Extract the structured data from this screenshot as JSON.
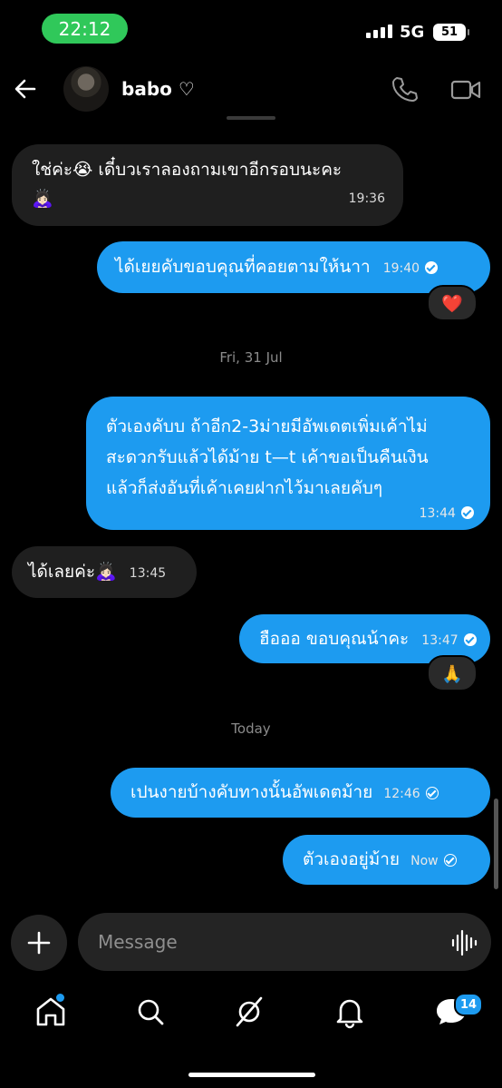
{
  "status": {
    "time": "22:12",
    "network": "5G",
    "battery": "51"
  },
  "header": {
    "name": "babo ♡"
  },
  "messages": [
    {
      "dir": "in",
      "text1": "ใช่ค่ะ😭 เดี๋บวเราลองถามเขาอีกรอบนะคะ",
      "text2": "🙇🏻‍♀️",
      "time": "19:36"
    },
    {
      "dir": "out",
      "text": "ได้เยยคับขอบคุณที่คอยตามให้นาา",
      "time": "19:40",
      "reaction": "❤️"
    },
    {
      "dir": "out",
      "lines": [
        "ตัวเองคับบ ถ้าอีก2-3ม่ายมีอัพเดตเพิ่มเค้าไม่",
        "สะดวกรับแล้วได้ม้าย t—t เค้าขอเป็นคืนเงิน",
        "แล้วก็ส่งอันที่เค้าเคยฝากไว้มาเลยคับๆ"
      ],
      "time": "13:44"
    },
    {
      "dir": "in",
      "text": "ได้เลยค่ะ🙇🏻‍♀️",
      "time": "13:45"
    },
    {
      "dir": "out",
      "text": "ฮือออ ขอบคุณน้าคะ",
      "time": "13:47",
      "reaction": "🙏"
    },
    {
      "dir": "out",
      "text": "เปนงายบ้างคับทางนั้นอัพเดตม้าย",
      "time": "12:46"
    },
    {
      "dir": "out",
      "text": "ตัวเองอยู่ม้าย",
      "time": "Now"
    }
  ],
  "separators": {
    "first": "Fri, 31 Jul",
    "second": "Today"
  },
  "composer": {
    "placeholder": "Message"
  },
  "nav": {
    "dm_badge": "14"
  },
  "colors": {
    "accent": "#1d9bf0",
    "incoming": "#1f1f1f",
    "status_pill": "#30c85a"
  }
}
